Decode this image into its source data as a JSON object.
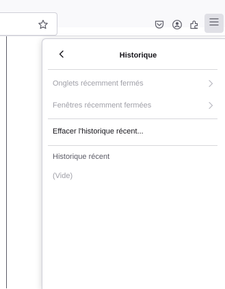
{
  "toolbar": {
    "icons": [
      "bookmark-star-icon",
      "pocket-icon",
      "account-icon",
      "extensions-icon",
      "hamburger-menu-icon"
    ]
  },
  "panel": {
    "title": "Historique",
    "items": [
      {
        "label": "Onglets récemment fermés",
        "enabled": false
      },
      {
        "label": "Fenêtres récemment fermées",
        "enabled": false
      }
    ],
    "clear_history_label": "Effacer l'historique récent...",
    "recent_history_heading": "Historique récent",
    "empty_label": "(Vide)"
  }
}
